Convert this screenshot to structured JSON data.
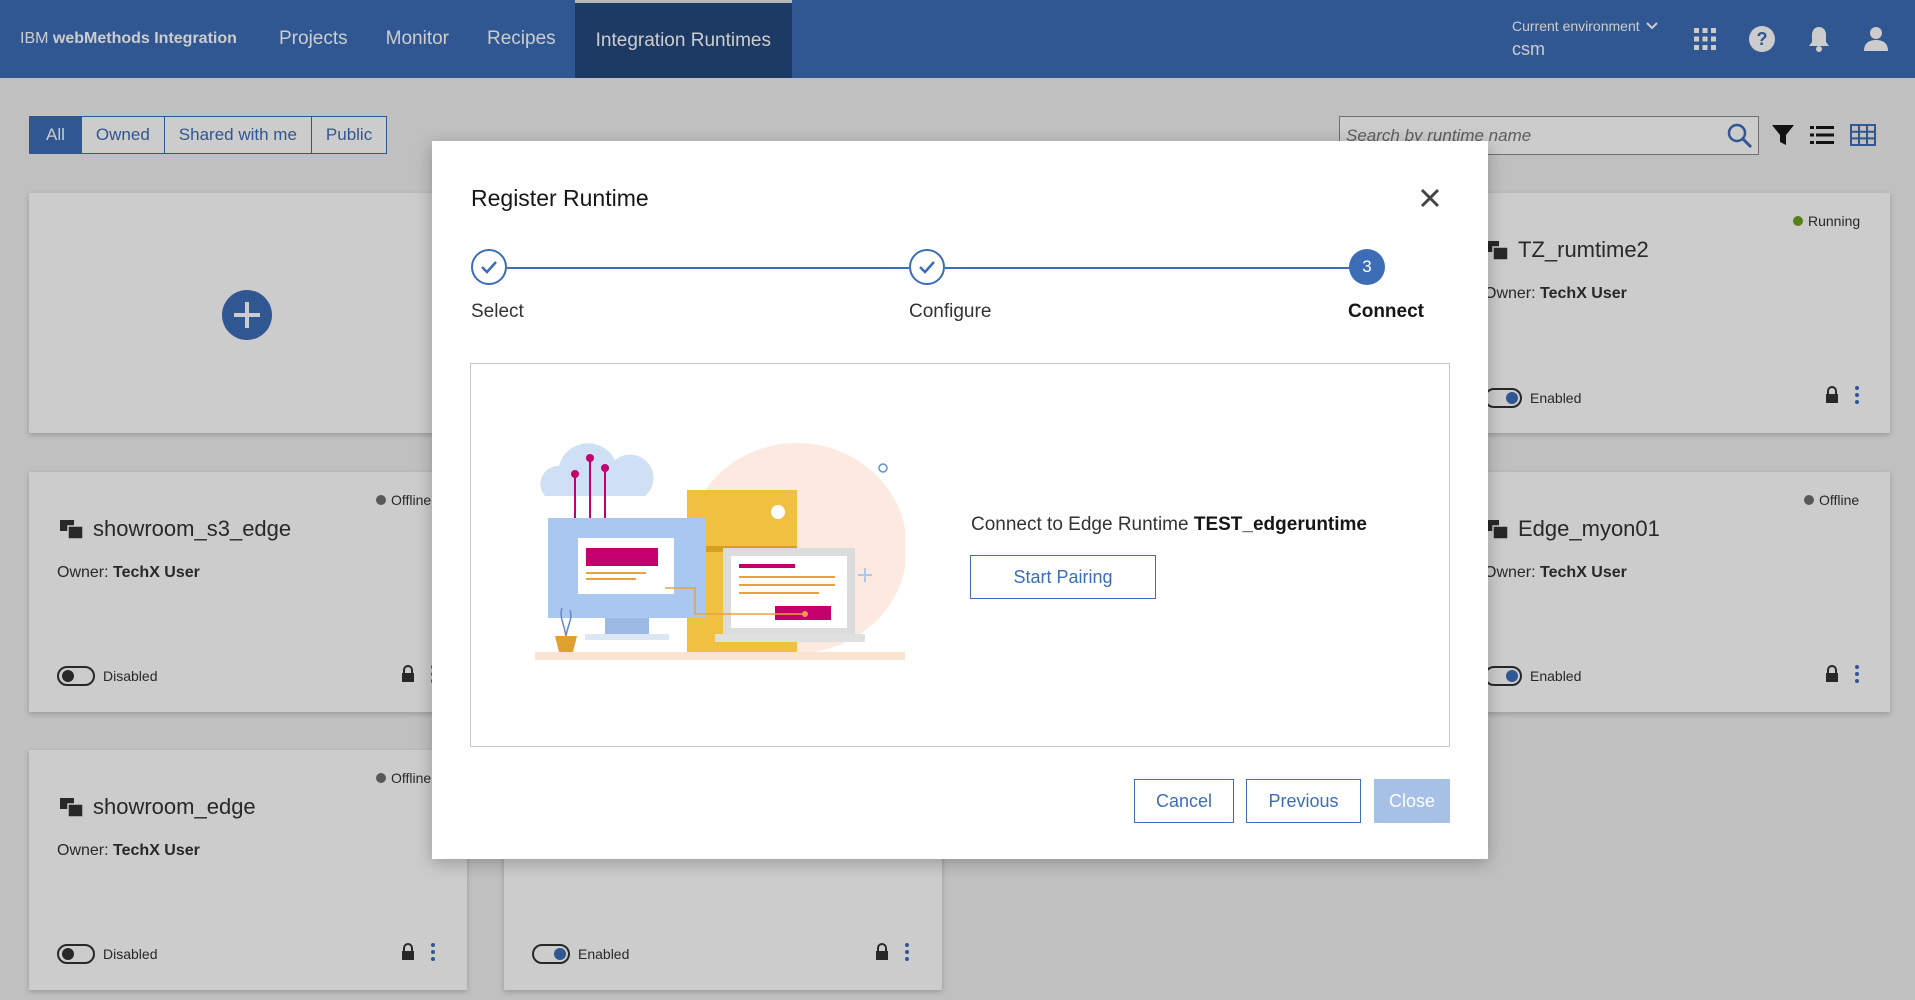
{
  "header": {
    "brand_prefix": "IBM ",
    "brand_name": "webMethods Integration",
    "nav": [
      {
        "label": "Projects"
      },
      {
        "label": "Monitor"
      },
      {
        "label": "Recipes"
      },
      {
        "label": "Integration Runtimes"
      }
    ],
    "active_nav": "Integration Runtimes",
    "environment_label": "Current environment",
    "environment_value": "csm",
    "icons": [
      "app-switcher-icon",
      "help-icon",
      "notification-icon",
      "user-icon"
    ]
  },
  "filter_tabs": [
    {
      "label": "All",
      "active": true
    },
    {
      "label": "Owned",
      "active": false
    },
    {
      "label": "Shared with me",
      "active": false
    },
    {
      "label": "Public",
      "active": false
    }
  ],
  "search": {
    "placeholder": "Search by runtime name"
  },
  "cards": [
    {
      "name": "TZ_rumtime2",
      "owner_label": "Owner:",
      "owner": "TechX User",
      "status": "Running",
      "toggle": "Enabled"
    },
    {
      "name": "showroom_s3_edge",
      "owner_label": "Owner:",
      "owner": "TechX User",
      "status": "Offline",
      "toggle": "Disabled"
    },
    {
      "name": "Edge_myon01",
      "owner_label": "Owner:",
      "owner": "TechX User",
      "status": "Offline",
      "toggle": "Enabled"
    },
    {
      "name": "showroom_edge",
      "owner_label": "Owner:",
      "owner": "TechX User",
      "status": "Offline",
      "toggle": "Disabled"
    },
    {
      "name": "",
      "owner_label": "",
      "owner": "",
      "status": "",
      "toggle": "Enabled"
    }
  ],
  "colors": {
    "brand": "#3c6db6",
    "running": "#6ca01e",
    "offline": "#6f6f6f"
  },
  "modal": {
    "title": "Register Runtime",
    "steps": [
      {
        "label": "Select",
        "state": "done"
      },
      {
        "label": "Configure",
        "state": "done"
      },
      {
        "label": "Connect",
        "state": "current",
        "number": "3"
      }
    ],
    "connect_prefix": "Connect to Edge Runtime ",
    "runtime_name": "TEST_edgeruntime",
    "start_pairing": "Start Pairing",
    "buttons": {
      "cancel": "Cancel",
      "previous": "Previous",
      "close": "Close"
    }
  }
}
